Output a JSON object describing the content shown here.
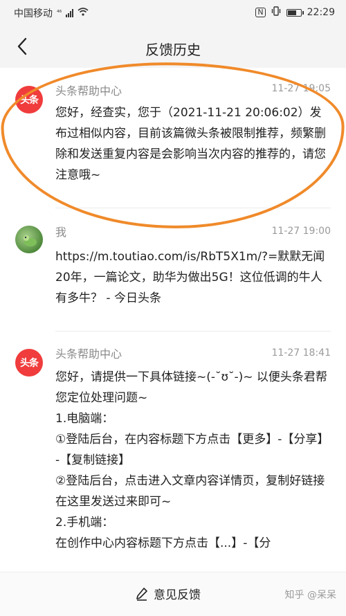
{
  "status_bar": {
    "carrier": "中国移动",
    "network": "⁴⁶",
    "nfc": "N",
    "time": "22:29"
  },
  "nav": {
    "title": "反馈历史",
    "back_icon": "chevron-left-icon"
  },
  "messages": [
    {
      "sender": "头条帮助中心",
      "avatar_text": "头条",
      "time": "11-27 19:05",
      "text": "您好，经查实，您于（2021-11-21 20:06:02）发布过相似内容，目前该篇微头条被限制推荐，频繁删除和发送重复内容是会影响当次内容的推荐的，请您注意哦~"
    },
    {
      "sender": "我",
      "time": "11-27 19:00",
      "text": "https://m.toutiao.com/is/RbT5X1m/?=默默无闻20年，一篇论文，助华为做出5G！这位低调的牛人有多牛？ - 今日头条"
    },
    {
      "sender": "头条帮助中心",
      "avatar_text": "头条",
      "time": "11-27 18:41",
      "lines": [
        "您好，请提供一下具体链接~(-˘ʊ˘-)~ 以便头条君帮您定位处理问题~",
        "1.电脑端：",
        "①登陆后台，在内容标题下方点击【更多】-【分享】-【复制链接】",
        "②登陆后台，点击进入文章内容详情页，复制好链接在这里发送过来即可~",
        "2.手机端：",
        "在创作中心内容标题下方点击【...】-【分"
      ]
    }
  ],
  "bottom": {
    "feedback_label": "意见反馈",
    "watermark": "知乎 @呆呆"
  },
  "colors": {
    "highlight": "#f08a2a",
    "logo_red": "#f03c3c"
  }
}
